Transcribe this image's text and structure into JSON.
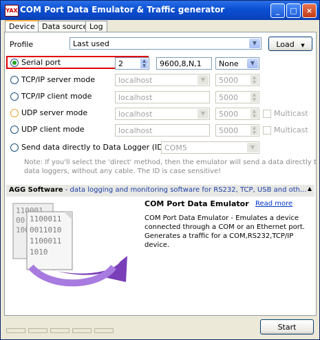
{
  "window": {
    "app_icon": "YAX",
    "title": "COM Port Data Emulator & Traffic generator",
    "buttons": {
      "minimize": "_",
      "maximize": "□",
      "close": "×"
    }
  },
  "tabs": [
    "Device",
    "Data source",
    "Log"
  ],
  "profile": {
    "label": "Profile",
    "value": "Last used",
    "load_label": "Load"
  },
  "modes": {
    "serial": {
      "label": "Serial port",
      "port": "2",
      "settings": "9600,8,N,1",
      "flow": "None"
    },
    "tcp_server": {
      "label": "TCP/IP server mode",
      "host": "localhost",
      "port": "5000"
    },
    "tcp_client": {
      "label": "TCP/IP client mode",
      "host": "localhost",
      "port": "5000"
    },
    "udp_server": {
      "label": "UDP server mode",
      "host": "localhost",
      "port": "5000",
      "multicast": "Multicast"
    },
    "udp_client": {
      "label": "UDP client mode",
      "host": "localhost",
      "port": "5000",
      "multicast": "Multicast"
    },
    "logger": {
      "label": "Send data directly to Data Logger (ID=)",
      "id": "COM5"
    }
  },
  "note": {
    "line1": "Note: If you'll select the 'direct' method, then the emulator will send a data directly to ours",
    "line2": "data loggers, without any cable. The ID is case sensitive!"
  },
  "info": {
    "brand": "AGG Software",
    "tagline": " - data logging and monitoring software for RS232, TCP, USB and oth...",
    "product": "COM Port Data Emulator",
    "read_more": "Read more",
    "desc1": "COM Port Data Emulator - Emulates a device",
    "desc2": "connected through a COM or an Ethernet port.",
    "desc3": "Generates a traffic for a COM,RS232,TCP/IP",
    "desc4": "device."
  },
  "graphic": {
    "page1": [
      "110001",
      "00",
      "1001"
    ],
    "page2": [
      "1100011",
      "0011010",
      "1100011",
      "1010"
    ]
  },
  "start_label": "Start",
  "colors": {
    "accent_red": "#e00000",
    "link": "#0033cc",
    "brand_blue": "#1a3ea8"
  }
}
